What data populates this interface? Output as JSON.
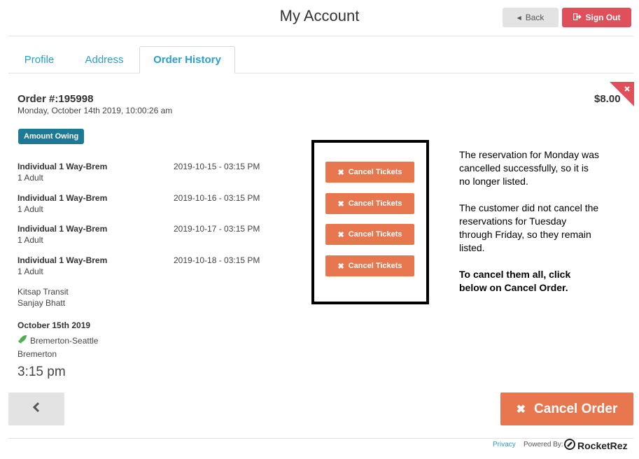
{
  "header": {
    "title": "My Account",
    "back_label": "Back",
    "signout_label": "Sign Out"
  },
  "tabs": [
    {
      "label": "Profile"
    },
    {
      "label": "Address"
    },
    {
      "label": "Order History"
    }
  ],
  "order": {
    "number": "Order #:195998",
    "date": "Monday, October 14th 2019, 10:00:26 am",
    "price": "$8.00",
    "badge": "Amount Owing",
    "items": [
      {
        "name": "Individual 1 Way-Brem",
        "qty": "1 Adult",
        "datetime": "2019-10-15 - 03:15 PM",
        "cancel_label": "Cancel Tickets"
      },
      {
        "name": "Individual 1 Way-Brem",
        "qty": "1 Adult",
        "datetime": "2019-10-16 - 03:15 PM",
        "cancel_label": "Cancel Tickets"
      },
      {
        "name": "Individual 1 Way-Brem",
        "qty": "1 Adult",
        "datetime": "2019-10-17 - 03:15 PM",
        "cancel_label": "Cancel Tickets"
      },
      {
        "name": "Individual 1 Way-Brem",
        "qty": "1 Adult",
        "datetime": "2019-10-18 - 03:15 PM",
        "cancel_label": "Cancel Tickets"
      }
    ],
    "operator": "Kitsap Transit",
    "customer": "Sanjay Bhatt",
    "trip_date": "October 15th 2019",
    "route": "Bremerton-Seattle",
    "origin": "Bremerton",
    "trip_time": "3:15 pm"
  },
  "note": {
    "para1": "The reservation for Monday was cancelled successfully, so it is no longer listed.",
    "para2": "The customer did not cancel the reservations for Tuesday through Friday, so they remain listed.",
    "para3": "To cancel them all, click below on Cancel Order."
  },
  "footer_actions": {
    "cancel_order_label": "Cancel Order"
  },
  "footer": {
    "privacy": "Privacy",
    "powered_by": "Powered By:",
    "brand": "RocketRez"
  },
  "colors": {
    "accent": "#2a9fc9",
    "danger": "#e0505a",
    "cancel": "#e8774f",
    "badge": "#1c7a94"
  },
  "icons": [
    "caret-left-icon",
    "sign-out-icon",
    "close-icon",
    "rocket-icon",
    "chevron-left-icon"
  ]
}
